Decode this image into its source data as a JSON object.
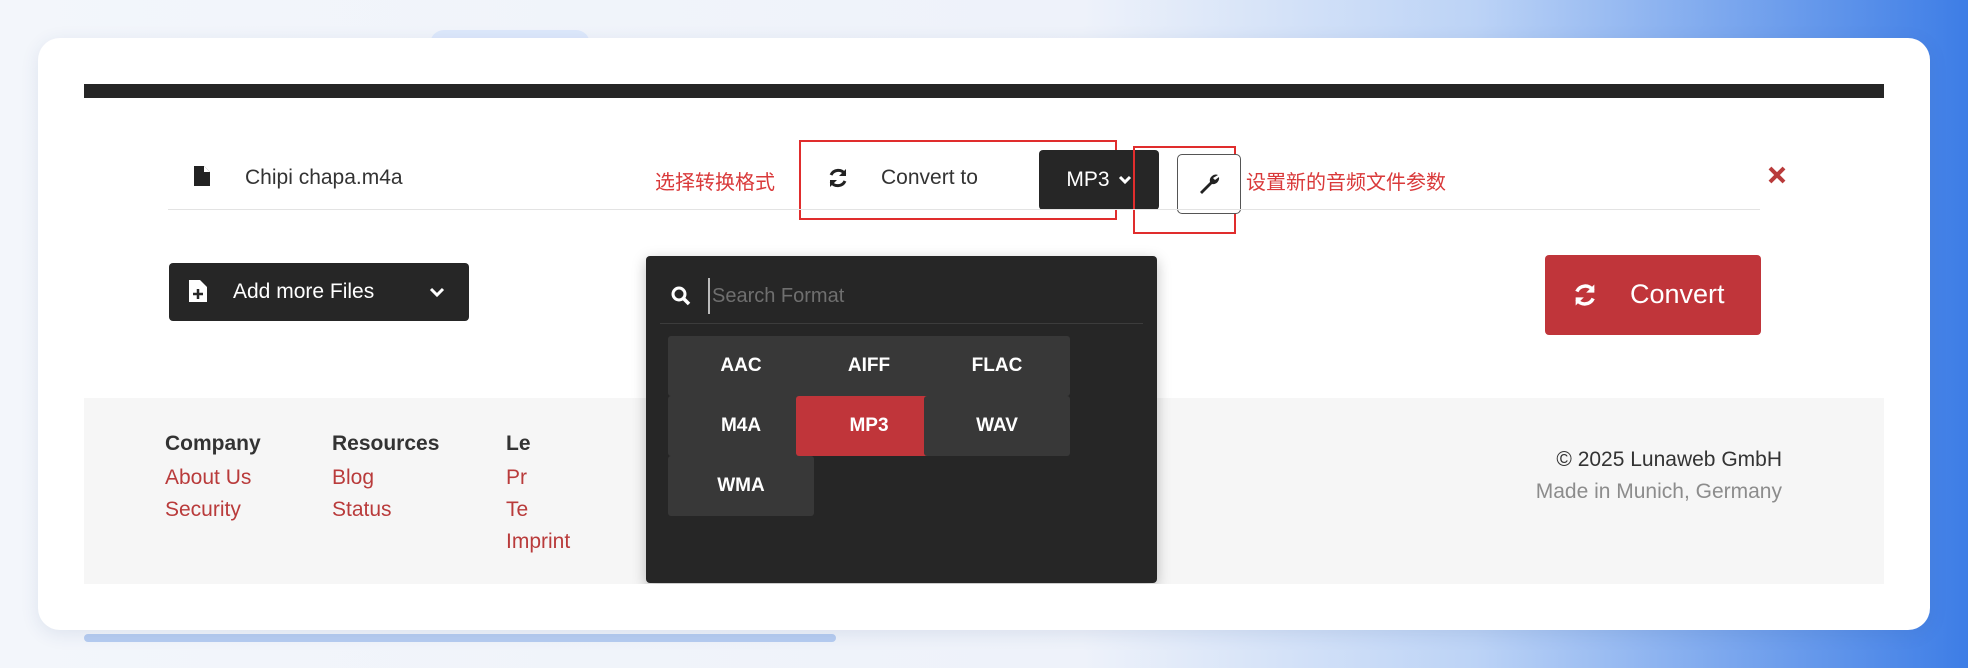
{
  "file": {
    "name": "Chipi chapa.m4a"
  },
  "annotations": {
    "left": "选择转换格式",
    "right": "设置新的音频文件参数"
  },
  "converter": {
    "convert_to_label": "Convert to",
    "selected_format": "MP3"
  },
  "buttons": {
    "add_more": "Add more Files",
    "convert": "Convert"
  },
  "dropdown": {
    "search_placeholder": "Search Format",
    "formats": [
      {
        "label": "AAC",
        "selected": false
      },
      {
        "label": "AIFF",
        "selected": false
      },
      {
        "label": "FLAC",
        "selected": false
      },
      {
        "label": "M4A",
        "selected": false
      },
      {
        "label": "MP3",
        "selected": true
      },
      {
        "label": "WAV",
        "selected": false
      },
      {
        "label": "WMA",
        "selected": false
      }
    ]
  },
  "footer": {
    "company": {
      "heading": "Company",
      "links": [
        "About Us",
        "Security"
      ]
    },
    "resources": {
      "heading": "Resources",
      "links": [
        "Blog",
        "Status"
      ]
    },
    "legal": {
      "heading": "Le",
      "links": [
        "Pr",
        "Te",
        "Imprint"
      ]
    },
    "copyright": "© 2025 Lunaweb GmbH",
    "made_in": "Made in Munich, Germany"
  },
  "colors": {
    "accent": "#c0353a",
    "dark": "#262626",
    "annotation": "#d9393a"
  },
  "icons": {
    "file": "file-icon",
    "sync": "sync-icon",
    "chevron": "chevron-down-icon",
    "wrench": "wrench-icon",
    "close": "close-icon",
    "search": "search-icon",
    "add_file": "file-plus-icon"
  }
}
